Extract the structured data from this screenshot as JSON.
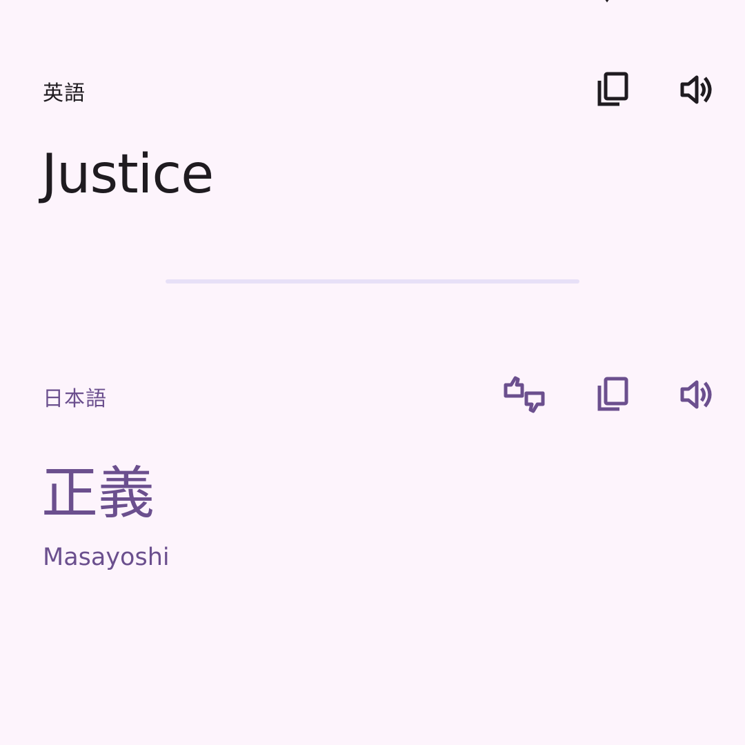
{
  "source": {
    "language": "英語",
    "text": "Justice"
  },
  "target": {
    "language": "日本語",
    "text": "正義",
    "romanization": "Masayoshi"
  },
  "icons": {
    "source_copy": "copy-icon",
    "source_speak": "volume-icon",
    "target_feedback": "rate-translation-icon",
    "target_copy": "copy-icon",
    "target_speak": "volume-icon"
  },
  "colors": {
    "background": "#fdf4fc",
    "primary_text": "#1f1b20",
    "accent": "#6b4f8e",
    "divider": "#e7e0f7"
  }
}
